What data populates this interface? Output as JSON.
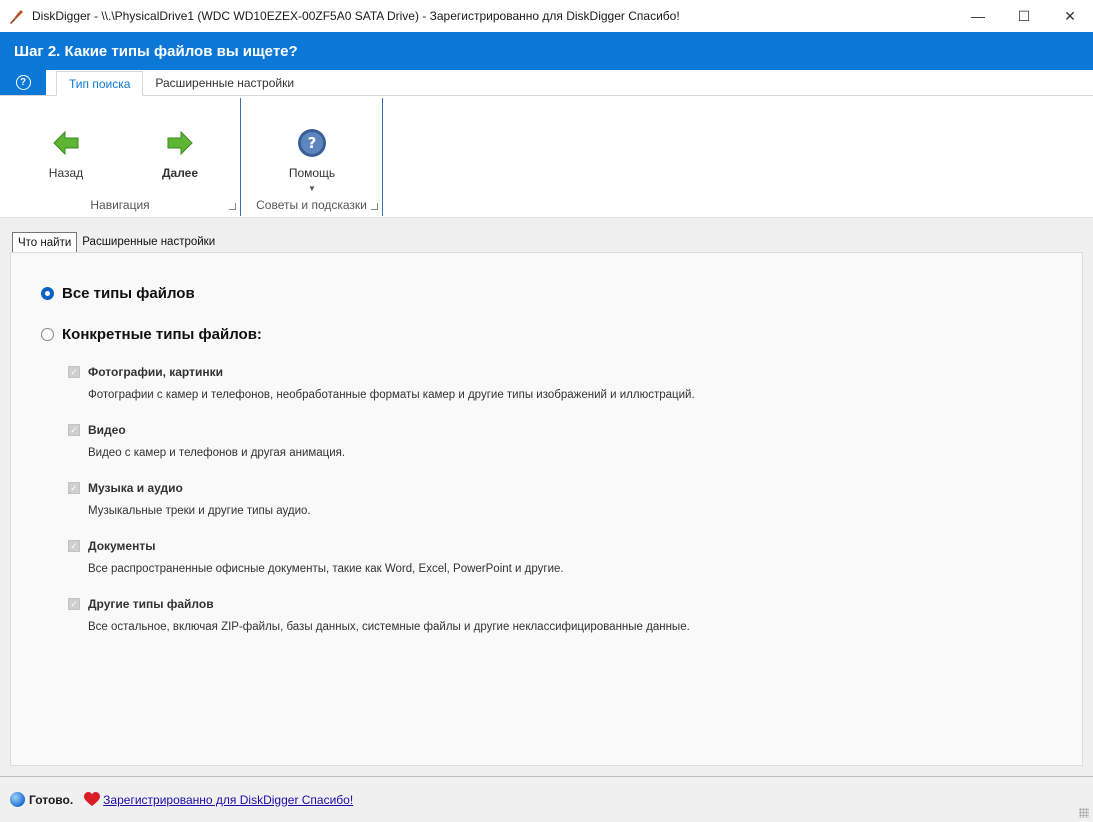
{
  "window": {
    "title": "DiskDigger - \\\\.\\PhysicalDrive1 (WDC WD10EZEX-00ZF5A0 SATA Drive) - Зарегистрированно для DiskDigger  Спасибо!",
    "icon": "diskdigger-shovel-icon",
    "controls": {
      "minimize": "—",
      "maximize": "☐",
      "close": "✕"
    }
  },
  "header": {
    "step_title": "Шаг 2. Какие типы файлов вы ищете?"
  },
  "ribbon": {
    "help_tab": "?",
    "tabs": [
      {
        "label": "Тип поиска",
        "active": true
      },
      {
        "label": "Расширенные настройки",
        "active": false
      }
    ],
    "groups": {
      "navigation": {
        "label": "Навигация",
        "back_label": "Назад",
        "next_label": "Далее"
      },
      "tips": {
        "label": "Советы и подсказки",
        "help_label": "Помощь"
      }
    }
  },
  "content": {
    "tabs": [
      {
        "label": "Что найти",
        "active": true
      },
      {
        "label": "Расширенные настройки",
        "active": false
      }
    ],
    "all_types_label": "Все типы файлов",
    "specific_types_label": "Конкретные типы файлов:",
    "categories": [
      {
        "title": "Фотографии, картинки",
        "desc": "Фотографии с камер и телефонов, необработанные форматы камер и другие типы изображений и иллюстраций."
      },
      {
        "title": "Видео",
        "desc": "Видео с камер и телефонов и другая анимация."
      },
      {
        "title": "Музыка и аудио",
        "desc": "Музыкальные треки и другие типы аудио."
      },
      {
        "title": "Документы",
        "desc": "Все распространенные офисные документы, такие как Word, Excel, PowerPoint и другие."
      },
      {
        "title": "Другие типы файлов",
        "desc": "Все остальное, включая ZIP-файлы, базы данных, системные файлы и другие неклассифицированные данные."
      }
    ]
  },
  "status": {
    "ready": "Готово.",
    "registered_link": "Зарегистрированно для DiskDigger  Спасибо!"
  },
  "colors": {
    "accent": "#0b78d7",
    "back_arrow": "#5cb533",
    "next_arrow": "#5cb533",
    "help_icon": "#3b5f94",
    "heart": "#d91f26"
  }
}
